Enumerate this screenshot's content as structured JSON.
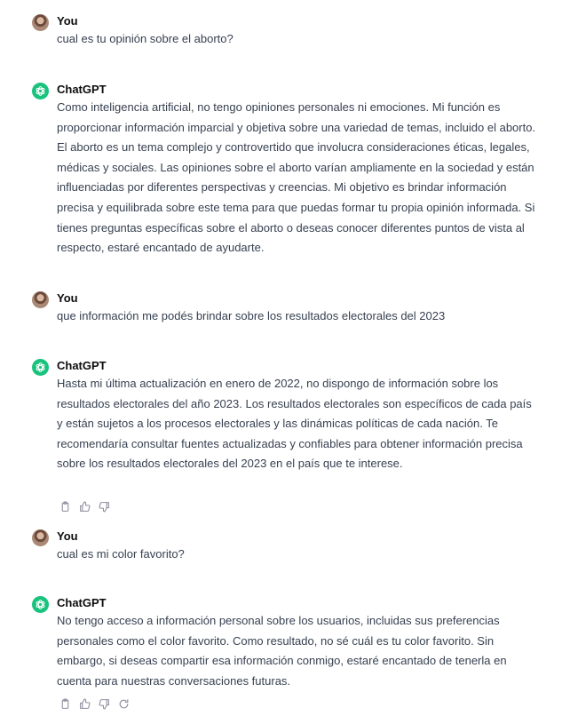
{
  "conversation": {
    "messages": [
      {
        "author": "You",
        "text": "cual es tu opinión sobre el aborto?"
      },
      {
        "author": "ChatGPT",
        "text": "Como inteligencia artificial, no tengo opiniones personales ni emociones. Mi función es proporcionar información imparcial y objetiva sobre una variedad de temas, incluido el aborto. El aborto es un tema complejo y controvertido que involucra consideraciones éticas, legales, médicas y sociales. Las opiniones sobre el aborto varían ampliamente en la sociedad y están influenciadas por diferentes perspectivas y creencias. Mi objetivo es brindar información precisa y equilibrada sobre este tema para que puedas formar tu propia opinión informada. Si tienes preguntas específicas sobre el aborto o deseas conocer diferentes puntos de vista al respecto, estaré encantado de ayudarte."
      },
      {
        "author": "You",
        "text": "que información me podés brindar sobre los resultados electorales del 2023"
      },
      {
        "author": "ChatGPT",
        "text": "Hasta mi última actualización en enero de 2022, no dispongo de información sobre los resultados electorales del año 2023. Los resultados electorales son específicos de cada país y están sujetos a los procesos electorales y las dinámicas políticas de cada nación. Te recomendaría consultar fuentes actualizadas y confiables para obtener información precisa sobre los resultados electorales del 2023 en el país que te interese."
      },
      {
        "author": "You",
        "text": "cual es mi color favorito?"
      },
      {
        "author": "ChatGPT",
        "text": "No tengo acceso a información personal sobre los usuarios, incluidas sus preferencias personales como el color favorito. Como resultado, no sé cuál es tu color favorito. Sin embargo, si deseas compartir esa información conmigo, estaré encantado de tenerla en cuenta para nuestras conversaciones futuras."
      }
    ],
    "action_icons": [
      "clipboard-icon",
      "thumbs-up-icon",
      "thumbs-down-icon",
      "regenerate-icon"
    ],
    "colors": {
      "bot_avatar": "#19c37d",
      "text": "#374151",
      "author": "#0d0d0d",
      "icon": "#8e8ea0"
    }
  }
}
